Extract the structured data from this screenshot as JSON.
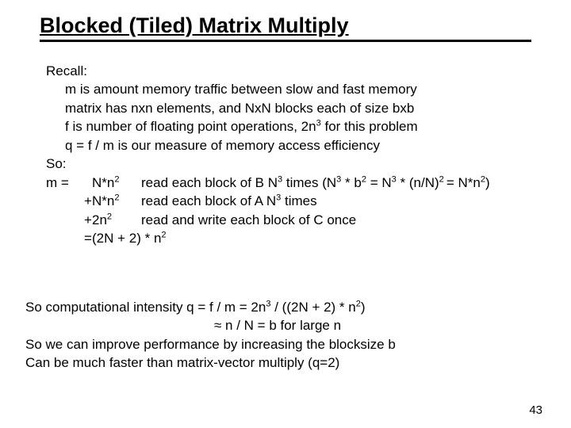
{
  "title": "Blocked (Tiled) Matrix Multiply",
  "recall_label": "Recall:",
  "recall_items": [
    "m is amount memory traffic between slow and fast memory",
    "matrix has nxn elements, and NxN blocks each of size bxb"
  ],
  "f_line_a": "f is number of floating point operations, 2n",
  "f_line_exp": "3",
  "f_line_b": " for this problem",
  "q_def": "q = f / m is our measure of memory access efficiency",
  "so_label": "So:",
  "m1_op": "m =  ",
  "m1_term_a": "N*n",
  "m1_term_exp": "2",
  "m1_desc_a": "read each block of B  N",
  "m1_desc_exp1": "3",
  "m1_desc_b": " times (N",
  "m1_desc_exp2": "3",
  "m1_desc_c": " * b",
  "m1_desc_exp3": "2",
  "m1_desc_d": " = N",
  "m1_desc_exp4": "3",
  "m1_desc_e": " * (n/N)",
  "m1_desc_exp5": "2 ",
  "m1_desc_f": "= N*n",
  "m1_desc_exp6": "2",
  "m1_desc_g": ")",
  "m2_op": "+ ",
  "m2_term_a": "N*n",
  "m2_term_exp": "2",
  "m2_desc_a": "read each block of A  N",
  "m2_desc_exp": "3",
  "m2_desc_b": " times",
  "m3_op": "+ ",
  "m3_term_a": "2n",
  "m3_term_exp": "2",
  "m3_desc": "read and write each block of C once",
  "m4_op": "=  ",
  "m4_term_a": "(2N + 2) * n",
  "m4_term_exp": "2",
  "ci_a": "So computational intensity q = f / m = 2n",
  "ci_exp1": "3",
  "ci_b": " / ((2N + 2) * n",
  "ci_exp2": "2",
  "ci_c": ")",
  "approx": "≈ n / N = b   for large n",
  "improve": "So we can improve performance by increasing the blocksize b",
  "faster": "Can be much faster than matrix-vector multiply (q=2)",
  "page": "43"
}
